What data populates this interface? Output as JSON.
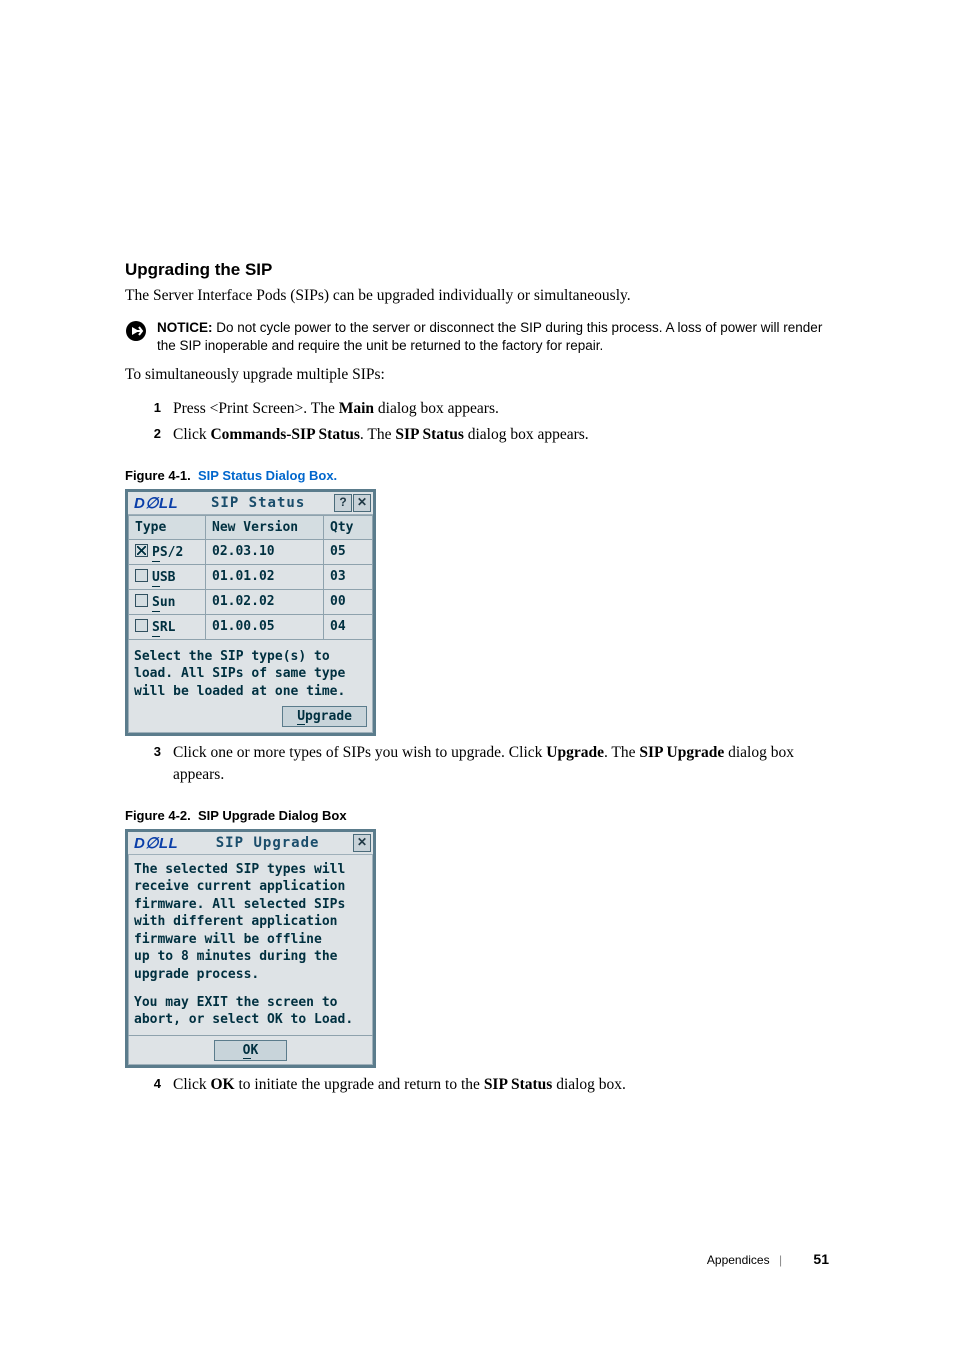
{
  "heading": "Upgrading the SIP",
  "intro": "The Server Interface Pods (SIPs) can be upgraded individually or simultaneously.",
  "notice": {
    "label": "NOTICE:",
    "text": "Do not cycle power to the server or disconnect the SIP during this process. A loss of power will render the SIP inoperable and require the unit be returned to the factory for repair."
  },
  "lead2": "To simultaneously upgrade multiple SIPs:",
  "step1_pre": "Press <Print Screen>. The ",
  "step1_bold": "Main",
  "step1_post": " dialog box appears.",
  "step2_pre": "Click ",
  "step2_bold1": "Commands-SIP Status",
  "step2_mid": ". The ",
  "step2_bold2": "SIP Status",
  "step2_post": " dialog box appears.",
  "fig1_num": "Figure 4-1.",
  "fig1_title": "SIP Status Dialog Box.",
  "dlg1": {
    "logo": "D∅LL",
    "title": "SIP Status",
    "help": "?",
    "close": "✕",
    "cols": {
      "type": "Type",
      "ver": "New Version",
      "qty": "Qty"
    },
    "rows": [
      {
        "checked": true,
        "first": "P",
        "rest": "S/2",
        "ver": "02.03.10",
        "qty": "05"
      },
      {
        "checked": false,
        "first": "U",
        "rest": "SB",
        "ver": "01.01.02",
        "qty": "03"
      },
      {
        "checked": false,
        "first": "S",
        "rest": "un",
        "ver": "01.02.02",
        "qty": "00"
      },
      {
        "checked": false,
        "first": "S",
        "rest": "RL",
        "ver": "01.00.05",
        "qty": "04"
      }
    ],
    "msg1": "Select the SIP type(s) to",
    "msg2": "load. All SIPs of same type",
    "msg3": "will be loaded at one time.",
    "btn_first": "U",
    "btn_rest": "pgrade"
  },
  "step3_pre": "Click one or more types of SIPs you wish to upgrade. Click ",
  "step3_bold1": "Upgrade",
  "step3_mid": ". The ",
  "step3_bold2": "SIP Upgrade",
  "step3_post": " dialog box appears.",
  "fig2_num": "Figure 4-2.",
  "fig2_title": "SIP Upgrade Dialog Box",
  "dlg2": {
    "logo": "D∅LL",
    "title": "SIP Upgrade",
    "close": "✕",
    "l1": "The selected SIP types will",
    "l2": "receive current application",
    "l3": "firmware. All selected SIPs",
    "l4": "with different application",
    "l5": "firmware will be offline",
    "l6": "up to 8 minutes during the",
    "l7": "upgrade process.",
    "l8": "You may EXIT the screen to",
    "l9": "abort, or select OK to Load.",
    "ok_first": "O",
    "ok_rest": "K"
  },
  "step4_pre": "Click ",
  "step4_bold1": "OK",
  "step4_mid": " to initiate the upgrade and return to the ",
  "step4_bold2": "SIP Status",
  "step4_post": " dialog box.",
  "footer": {
    "section": "Appendices",
    "page": "51"
  }
}
